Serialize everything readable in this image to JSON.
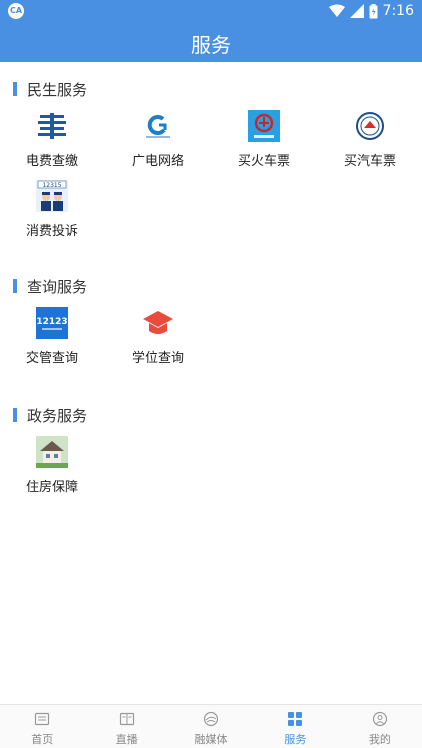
{
  "status_bar": {
    "app_badge": "CA",
    "time": "7:16"
  },
  "header": {
    "title": "服务"
  },
  "sections": [
    {
      "title": "民生服务",
      "items": [
        {
          "label": "电费查缴",
          "icon": "power-grid-icon"
        },
        {
          "label": "广电网络",
          "icon": "cable-network-icon"
        },
        {
          "label": "买火车票",
          "icon": "railway-icon"
        },
        {
          "label": "买汽车票",
          "icon": "bus-ticket-icon"
        },
        {
          "label": "消费投诉",
          "icon": "consumer-complaint-icon"
        }
      ]
    },
    {
      "title": "查询服务",
      "items": [
        {
          "label": "交管查询",
          "icon": "traffic-12123-icon"
        },
        {
          "label": "学位查询",
          "icon": "graduation-cap-icon"
        }
      ]
    },
    {
      "title": "政务服务",
      "items": [
        {
          "label": "住房保障",
          "icon": "house-icon"
        }
      ]
    }
  ],
  "tab_bar": [
    {
      "label": "首页",
      "icon": "home-icon"
    },
    {
      "label": "直播",
      "icon": "live-icon"
    },
    {
      "label": "融媒体",
      "icon": "media-icon"
    },
    {
      "label": "服务",
      "icon": "grid-icon",
      "active": true
    },
    {
      "label": "我的",
      "icon": "profile-icon"
    }
  ],
  "colors": {
    "primary": "#4a90e2",
    "tab_inactive": "#888888"
  }
}
